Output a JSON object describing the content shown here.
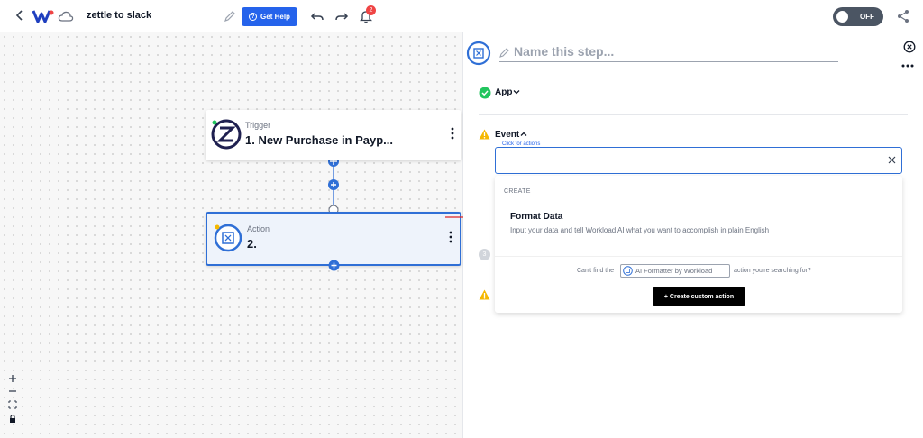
{
  "header": {
    "title": "zettle to slack",
    "help_label": "Get Help",
    "notification_count": "2",
    "toggle_label": "OFF"
  },
  "canvas": {
    "trigger": {
      "kind": "Trigger",
      "name": "1. New Purchase in Payp..."
    },
    "action": {
      "kind": "Action",
      "name": "2."
    }
  },
  "panel": {
    "step_placeholder": "Name this step...",
    "app_label": "App",
    "event_label": "Event",
    "input_label": "Click for actions",
    "step3_number": "3",
    "dropdown": {
      "section_header": "CREATE",
      "option_title": "Format Data",
      "option_description": "Input your data and tell Workload AI what you want to accomplish in plain English",
      "cant_find_prefix": "Can't find the",
      "chip_label": "AI Formatter by Workload",
      "cant_find_suffix": "action you're searching for?",
      "custom_action_label": "+ Create custom action"
    }
  },
  "colors": {
    "accent": "#2563eb",
    "node_selected_border": "#2f6fd6",
    "success": "#22c55e",
    "warning": "#f5b800",
    "badge": "#ef4444",
    "arrow": "#dc2626"
  }
}
